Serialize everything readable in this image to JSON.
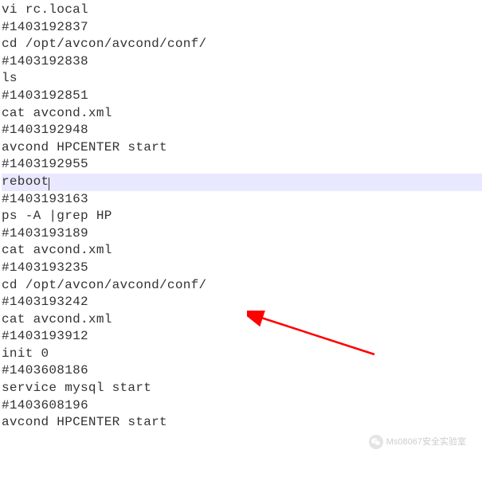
{
  "lines": [
    {
      "text": "vi rc.local",
      "highlighted": false
    },
    {
      "text": "#1403192837",
      "highlighted": false
    },
    {
      "text": "cd /opt/avcon/avcond/conf/",
      "highlighted": false
    },
    {
      "text": "#1403192838",
      "highlighted": false
    },
    {
      "text": "ls",
      "highlighted": false
    },
    {
      "text": "#1403192851",
      "highlighted": false
    },
    {
      "text": "cat avcond.xml",
      "highlighted": false
    },
    {
      "text": "#1403192948",
      "highlighted": false
    },
    {
      "text": "avcond HPCENTER start",
      "highlighted": false
    },
    {
      "text": "#1403192955",
      "highlighted": false
    },
    {
      "text": "reboot",
      "highlighted": true,
      "cursor": true
    },
    {
      "text": "#1403193163",
      "highlighted": false
    },
    {
      "text": "ps -A |grep HP",
      "highlighted": false
    },
    {
      "text": "#1403193189",
      "highlighted": false
    },
    {
      "text": "cat avcond.xml",
      "highlighted": false
    },
    {
      "text": "#1403193235",
      "highlighted": false
    },
    {
      "text": "cd /opt/avcon/avcond/conf/",
      "highlighted": false
    },
    {
      "text": "#1403193242",
      "highlighted": false
    },
    {
      "text": "cat avcond.xml",
      "highlighted": false
    },
    {
      "text": "#1403193912",
      "highlighted": false
    },
    {
      "text": "init 0",
      "highlighted": false
    },
    {
      "text": "#1403608186",
      "highlighted": false
    },
    {
      "text": "service mysql start",
      "highlighted": false
    },
    {
      "text": "#1403608196",
      "highlighted": false
    },
    {
      "text": "avcond HPCENTER start",
      "highlighted": false
    }
  ],
  "watermark": {
    "text": "Ms08067安全实验室"
  }
}
